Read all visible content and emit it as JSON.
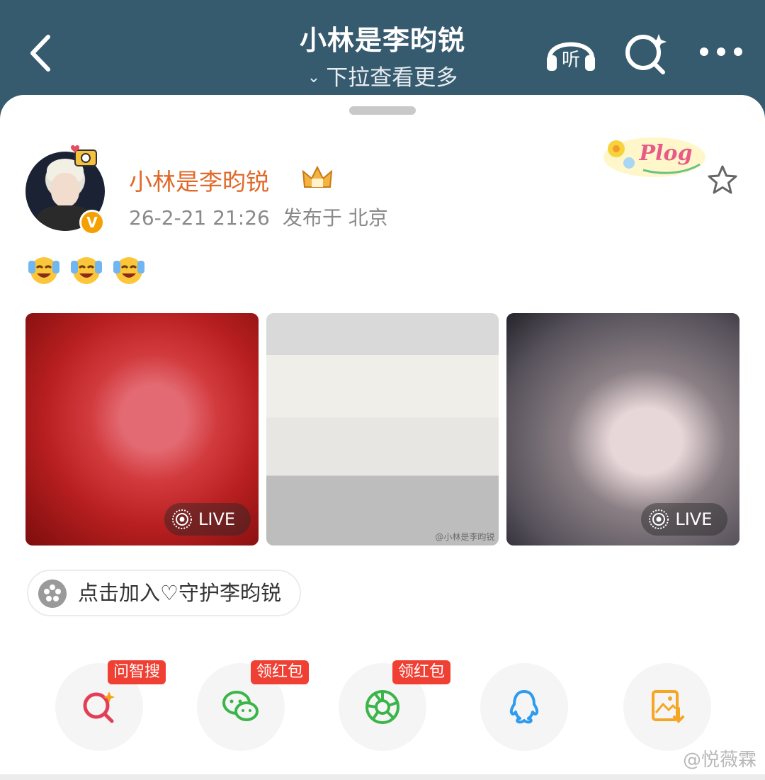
{
  "header": {
    "title": "小林是李昀锐",
    "subtitle": "下拉查看更多",
    "listen_label": "听"
  },
  "post": {
    "username": "小林是李昀锐",
    "time": "26-2-21 21:26",
    "location": "发布于 北京",
    "verified_badge": "V",
    "plog_sticker": "Plog",
    "images": [
      {
        "live": "LIVE"
      },
      {
        "watermark": "@小林是李昀锐"
      },
      {
        "live": "LIVE"
      }
    ],
    "guard_chip": "点击加入♡守护李昀锐"
  },
  "share": {
    "items": [
      {
        "icon": "ai-search-icon",
        "badge": "问智搜"
      },
      {
        "icon": "wechat-icon",
        "badge": "领红包"
      },
      {
        "icon": "moments-icon",
        "badge": "领红包"
      },
      {
        "icon": "qq-icon",
        "badge": ""
      },
      {
        "icon": "save-image-icon",
        "badge": ""
      }
    ]
  },
  "footer_watermark": "@悦薇霖",
  "colors": {
    "header_bg": "#365a6e",
    "username": "#e0692a",
    "badge_red": "#f04034"
  }
}
